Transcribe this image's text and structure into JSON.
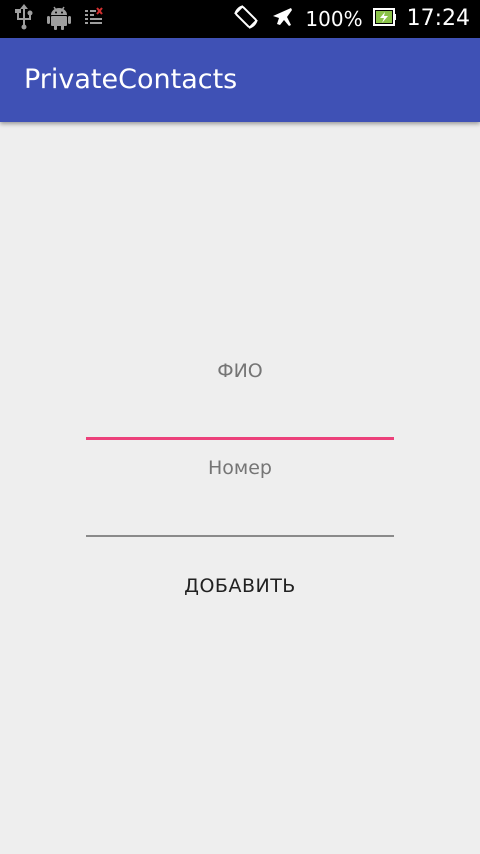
{
  "status_bar": {
    "icons_left": [
      "usb-icon",
      "android-debug-icon",
      "sim-icon"
    ],
    "icons_right": [
      "auto-rotate-icon",
      "airplane-mode-icon",
      "battery-charging-icon"
    ],
    "battery_text": "100%",
    "time": "17:24"
  },
  "app_bar": {
    "title": "PrivateContacts",
    "color": "#3f51b5"
  },
  "form": {
    "name_label": "ФИО",
    "name_value": "",
    "phone_label": "Номер",
    "phone_value": "",
    "add_button_label": "ДОБАВИТЬ",
    "accent_color": "#ec407a"
  }
}
